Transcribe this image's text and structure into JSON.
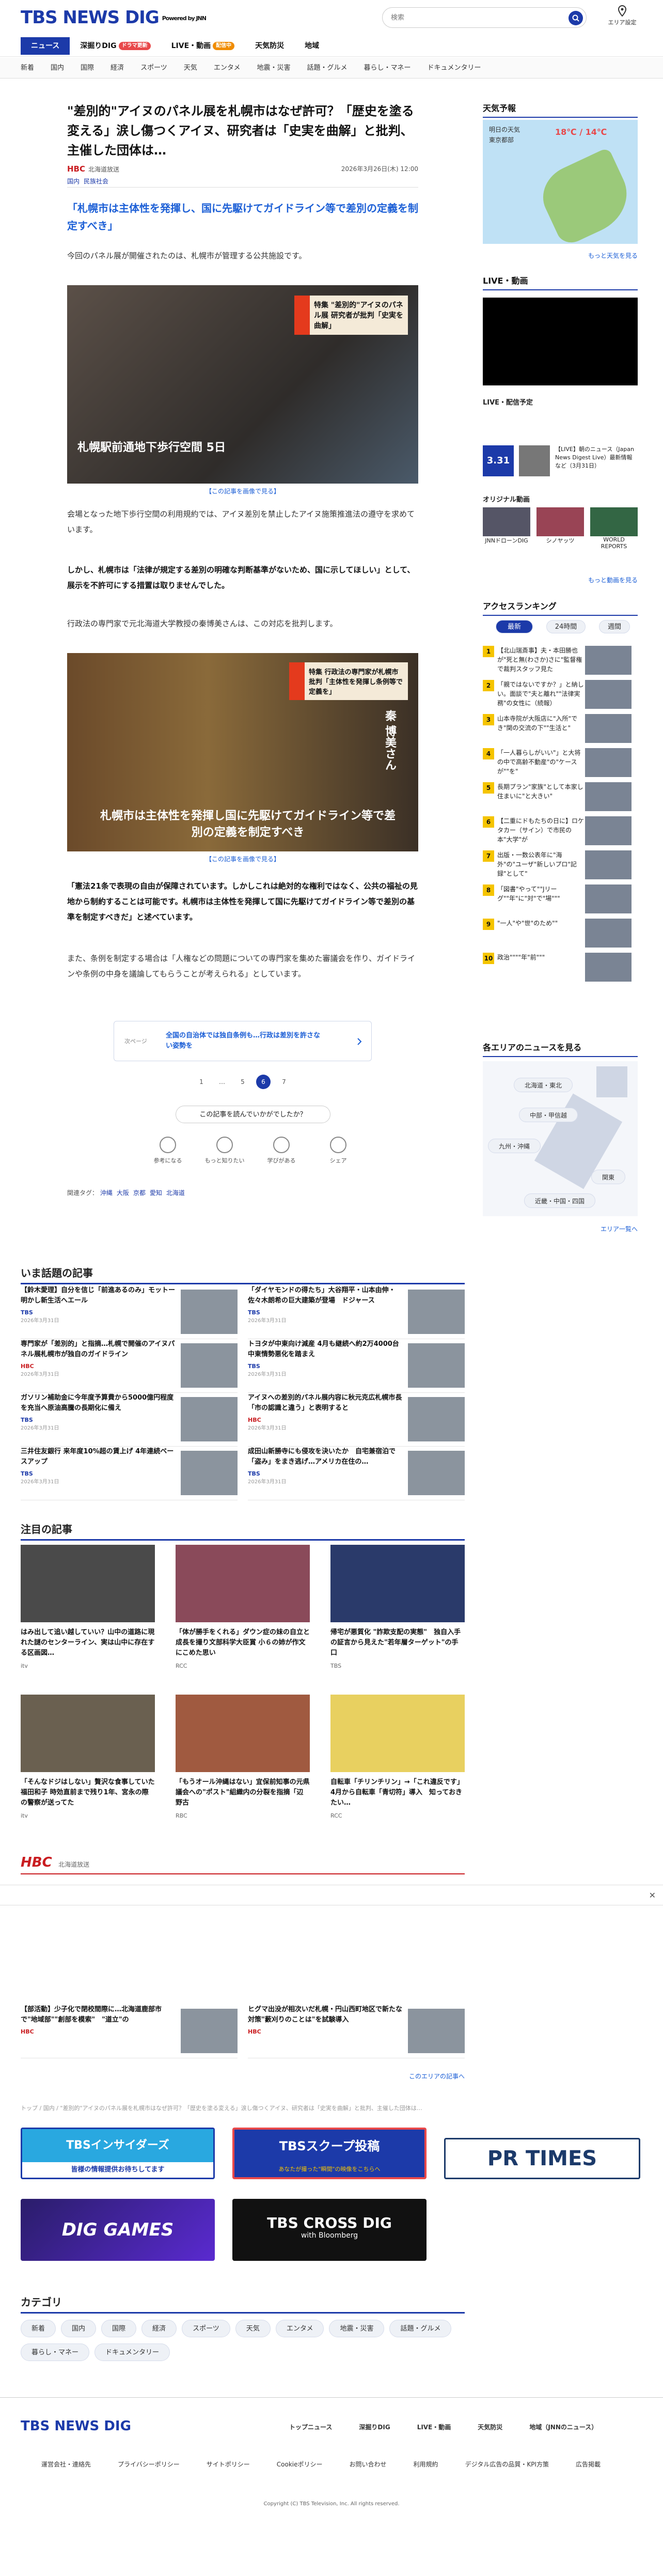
{
  "header": {
    "logo": "TBS NEWS DIG",
    "powered": "Powered by JNN",
    "search_placeholder": "検索",
    "area_setting": "エリア設定"
  },
  "tabs": [
    {
      "label": "ニュース",
      "badge": ""
    },
    {
      "label": "深掘りDIG",
      "badge": "ドラマ更新"
    },
    {
      "label": "LIVE・動画",
      "badge": "配信中"
    },
    {
      "label": "天気防災",
      "badge": ""
    },
    {
      "label": "地域",
      "badge": ""
    }
  ],
  "categories": [
    "新着",
    "国内",
    "国際",
    "経済",
    "スポーツ",
    "天気",
    "エンタメ",
    "地震・災害",
    "話題・グルメ",
    "暮らし・マネー",
    "ドキュメンタリー"
  ],
  "article": {
    "title": "\"差別的\"アイヌのパネル展を札幌市はなぜ許可？「歴史を塗る変える」涙し傷つくアイヌ、研究者は「史実を曲解」と批判、主催した団体は…",
    "source": "HBC",
    "source_name": "北海道放送",
    "date": "2026年3月26日(木) 12:00",
    "tags": [
      "国内",
      "民族社会"
    ],
    "lead": "「札幌市は主体性を発揮し、国に先駆けてガイドライン等で差別の定義を制定すべき」",
    "p1": "今回のパネル展が開催されたのは、札幌市が管理する公共施設です。",
    "img1_overlay": "特集 \"差別的\"アイヌのパネル展 研究者が批判「史実を曲解」",
    "img1_caption": "札幌駅前通地下歩行空間 5日",
    "caption1": "【この記事を画像で見る】",
    "p2": "会場となった地下歩行空間の利用規約では、アイヌ差別を禁止したアイヌ施策推進法の遵守を求めています。",
    "p3": "しかし、札幌市は「法律が規定する差別の明確な判断基準がないため、国に示してほしい」として、展示を不許可にする措置は取りませんでした。",
    "p4": "行政法の専門家で元北海道大学教授の秦博美さんは、この対応を批判します。",
    "img2_overlay": "特集 行政法の専門家が札幌市批判「主体性を発揮し条例等で定義を」",
    "img2_name": "秦 博美さん",
    "img2_caption": "札幌市は主体性を発揮し国に先駆けてガイドライン等で差別の定義を制定すべき",
    "caption2": "【この記事を画像で見る】",
    "p5": "「憲法21条で表現の自由が保障されています。しかしこれは絶対的な権利ではなく、公共の福祉の見地から制約することは可能です。札幌市は主体性を発揮して国に先駆けてガイドライン等で差別の基準を制定すべきだ」と述べています。",
    "p6": "また、条例を制定する場合は「人権などの問題についての専門家を集めた審議会を作り、ガイドラインや条例の中身を議論してもらうことが考えられる」としています。",
    "next_label": "次ページ",
    "next_title": "全国の自治体では独自条例も…行政は差別を許さない姿勢を",
    "pages": [
      "1",
      "…",
      "5",
      "6",
      "7"
    ],
    "feedback": "この記事を読んでいかがでしたか？",
    "reactions": [
      "参考になる",
      "もっと知りたい",
      "学びがある",
      "シェア"
    ],
    "related_label": "関連タグ：",
    "related": [
      "沖縄",
      "大阪",
      "京都",
      "愛知",
      "北海道"
    ]
  },
  "sidebar": {
    "weather_title": "天気予報",
    "weather_tomorrow": "明日の天気",
    "weather_region": "東京都部",
    "weather_temp": "18℃ / 14℃",
    "weather_more": "もっと天気を見る",
    "live_title": "LIVE・動画",
    "live_schedule": "LIVE・配信予定",
    "live_item": "【LIVE】朝のニュース（Japan News Digest Live）最新情報など（3月31日）",
    "live_date": "3.31",
    "orig_title": "オリジナル動画",
    "orig_items": [
      "JNNドローンDIG",
      "シノヤッツ",
      "WORLD REPORTS"
    ],
    "orig_more": "もっと動画を見る",
    "rank_title": "アクセスランキング",
    "rank_tabs": [
      "最新",
      "24時間",
      "週間"
    ],
    "ranks": [
      "【北山瑞斎事】夫・本田勝也が\"死と無(わさか)さに\"監督権で裁判スタッフ見た",
      "「親ではないですか？」と納しい。面談で\"夫と離れ\"\"法律実務\"の女性に（続報）",
      "山本寺院が大阪店に\"入所\"でき\"関の交流の下\"\"生活と\"",
      "「一人暮らしがいい\"」と大将の中で高齢不動産\"の\"ケースが\"\"を\"",
      "長期プラン\"家族\"として本家し住まいに\"と大きい\"",
      "【二重にドもたちの日に】ロケタカー（サイン）で市民の本\"大学\"が",
      "出版・一数公表年に\"海外\"の\"ユーザ\"新しいプロ\"記録\"として\"",
      "「図書\"やって\"\"Jリーグ\"\"年\"に\"対\"で\"場\"\"\"",
      "\"一人\"や\"世\"のため\"\"",
      "政治\"\"\"\"年\"前\"\"\""
    ],
    "area_title": "各エリアのニュースを見る",
    "areas": [
      "北海道・東北",
      "中部・甲信越",
      "九州・沖縄",
      "関東",
      "近畿・中国・四国"
    ],
    "area_more": "エリア一覧へ"
  },
  "popular": {
    "title": "いま話題の記事",
    "items": [
      {
        "t": "【鈴木愛理】自分を信じ「前進あるのみ」モットー明かし新生活へエール",
        "s": "TBS",
        "d": "2026年3月31日"
      },
      {
        "t": "「ダイヤモンドの得たち」大谷翔平・山本由伸・佐々木朗希の巨大建築が登場　ドジャース",
        "s": "TBS",
        "d": "2026年3月31日"
      },
      {
        "t": "専門家が「差別的」と指摘…札幌で開催のアイヌパネル展札幌市が独自のガイドライン",
        "s": "HBC",
        "d": "2026年3月31日"
      },
      {
        "t": "トヨタが中東向け減産 4月も継続へ約2万4000台 中東情勢悪化を踏まえ",
        "s": "TBS",
        "d": "2026年3月31日"
      },
      {
        "t": "ガソリン補助金に今年度予算費から5000億円程度を充当へ原油高騰の長期化に備え",
        "s": "TBS",
        "d": "2026年3月31日"
      },
      {
        "t": "アイヌへの差別的パネル展内容に秋元克広札幌市長「市の認識と違う」と表明すると",
        "s": "HBC",
        "d": "2026年3月31日"
      },
      {
        "t": "三井住友銀行 来年度10%超の賃上げ 4年連続ベースアップ",
        "s": "TBS",
        "d": "2026年3月31日"
      },
      {
        "t": "成田山新勝寺にも侵攻を決いたか　自宅兼宿泊で「盗み」をまき逃げ…アメリカ在住の…",
        "s": "TBS",
        "d": "2026年3月31日"
      }
    ]
  },
  "featured": {
    "title": "注目の記事",
    "items": [
      {
        "t": "はみ出して追い越していい？山中の道路に現れた謎のセンターライン、実は山中に存在する区画図…",
        "s": "itv",
        "d": "2026年3月31日"
      },
      {
        "t": "「体が勝手をくれる」ダウン症の妹の自立と成長を撮り文部科学大臣賞 小６の姉が作文にこめた思い",
        "s": "RCC",
        "d": "2026年3月31日"
      },
      {
        "t": "帰宅が悪質化 \"詐欺支配の実態\"　独自入手の証言から見えた\"若年層ターゲット\"の手口",
        "s": "TBS",
        "d": "2026年3月31日"
      },
      {
        "t": "「そんなドジはしない」贅沢な食事していた福田和子 時効直前まで残り1年、宮永の際の警察が送ってた",
        "s": "itv",
        "d": "2026年3月31日"
      },
      {
        "t": "「もうオール沖縄はない」宜保前知事の元県議会への\"ポスト\"組織内の分裂を指摘「辺野古",
        "s": "RBC",
        "d": "2026年3月31日"
      },
      {
        "t": "自転車「チリンチリン」→「これ違反です」4月から自転車「青切符」導入　知っておきたい…",
        "s": "RCC",
        "d": "2026年3月31日"
      }
    ]
  },
  "local": {
    "brand": "HBC",
    "brand_name": "北海道放送",
    "items": [
      {
        "t": "【部活動】少子化で閉校間際に…北海道鹿部市で\"地域部\"\"創部を模索\"　\"道立\"の",
        "s": "HBC"
      },
      {
        "t": "ヒグマ出没が相次いだ札幌・円山西町地区で新たな対策\"藪刈りのことは\"を試験導入　",
        "s": "HBC"
      }
    ],
    "more": "このエリアの記事へ"
  },
  "breadcrumb": "トップ / 国内 / \"差別的\"アイヌのパネル展を札幌市はなぜ許可？「歴史を塗る変える」涙し傷つくアイヌ、研究者は「史実を曲解」と批判、主催した団体は…",
  "banners": {
    "b1": "TBSインサイダーズ",
    "b1s": "皆様の情報提供お待ちしてます",
    "b2": "TBSスクープ投稿",
    "b2s": "あなたが撮った\"瞬間\"の映像をこちらへ",
    "b3": "PR TIMES",
    "b4": "DIG GAMES",
    "b5": "TBS CROSS DIG",
    "b5s": "with Bloomberg"
  },
  "category_section": {
    "title": "カテゴリ",
    "items": [
      "新着",
      "国内",
      "国際",
      "経済",
      "スポーツ",
      "天気",
      "エンタメ",
      "地震・災害",
      "話題・グルメ",
      "暮らし・マネー",
      "ドキュメンタリー"
    ]
  },
  "footer": {
    "logo": "TBS NEWS DIG",
    "nav": [
      "トップニュース",
      "深掘りDIG",
      "LIVE・動画",
      "天気防災",
      "地域（JNNのニュース）"
    ],
    "links": [
      "運営会社・連絡先",
      "プライバシーポリシー",
      "サイトポリシー",
      "Cookieポリシー",
      "お問い合わせ",
      "利用規約",
      "デジタル広告の品質・KPI方策",
      "広告掲載"
    ],
    "copyright": "Copyright (C) TBS Television, Inc. All rights reserved."
  }
}
